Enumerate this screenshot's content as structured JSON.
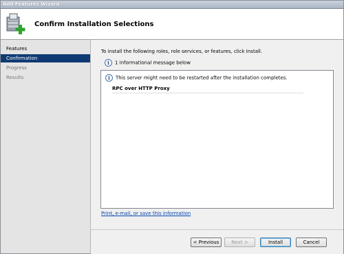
{
  "window": {
    "title": "Add Features Wizard"
  },
  "header": {
    "heading": "Confirm Installation Selections"
  },
  "nav": {
    "items": [
      {
        "label": "Features",
        "state": "done"
      },
      {
        "label": "Confirmation",
        "state": "active"
      },
      {
        "label": "Progress",
        "state": "pending"
      },
      {
        "label": "Results",
        "state": "pending"
      }
    ]
  },
  "main": {
    "intro": "To install the following roles, role services, or features, click Install.",
    "info_count_text": "1 informational message below",
    "warning_text": "This server might need to be restarted after the installation completes.",
    "feature_name": "RPC over HTTP Proxy",
    "print_link": "Print, e-mail, or save this information"
  },
  "buttons": {
    "previous": "< Previous",
    "next": "Next >",
    "install": "Install",
    "cancel": "Cancel"
  },
  "icons": {
    "info": "i",
    "wizard": "server-add-feature-icon"
  },
  "colors": {
    "nav_active_bg": "#0f3a73",
    "link": "#0645ad",
    "title_bar": "#aab5c4"
  }
}
